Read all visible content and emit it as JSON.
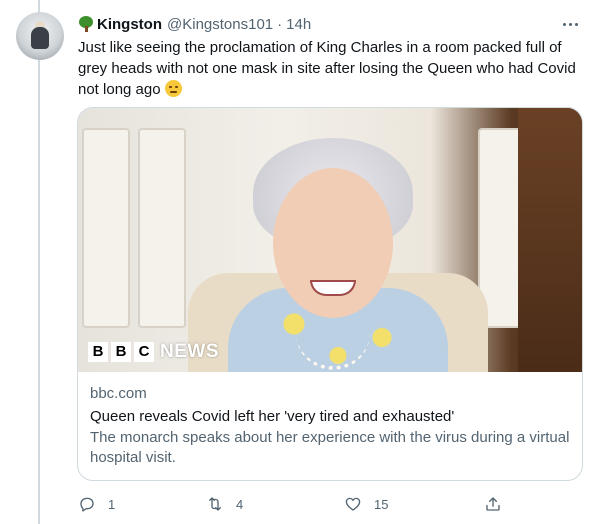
{
  "tweet": {
    "display_name": "Kingston",
    "handle": "@Kingstons101",
    "separator": "·",
    "time": "14h",
    "text": "Just like seeing the proclamation of King Charles in a room packed full of grey heads with not one mask in site after losing the Queen who had Covid not long ago",
    "emoji": "disappointed-face-emoji"
  },
  "card": {
    "image_logo": {
      "letters": [
        "B",
        "B",
        "C"
      ],
      "word": "NEWS"
    },
    "domain": "bbc.com",
    "title": "Queen reveals Covid left her 'very tired and exhausted'",
    "description": "The monarch speaks about her experience with the virus during a virtual hospital visit."
  },
  "actions": {
    "reply_count": "1",
    "retweet_count": "4",
    "like_count": "15"
  },
  "icons": {
    "name_emoji": "tree-icon",
    "more": "more-icon",
    "reply": "reply-icon",
    "retweet": "retweet-icon",
    "like": "heart-icon",
    "share": "share-icon"
  },
  "colors": {
    "text_primary": "#0f1419",
    "text_secondary": "#536471",
    "border": "#cfd9de"
  }
}
